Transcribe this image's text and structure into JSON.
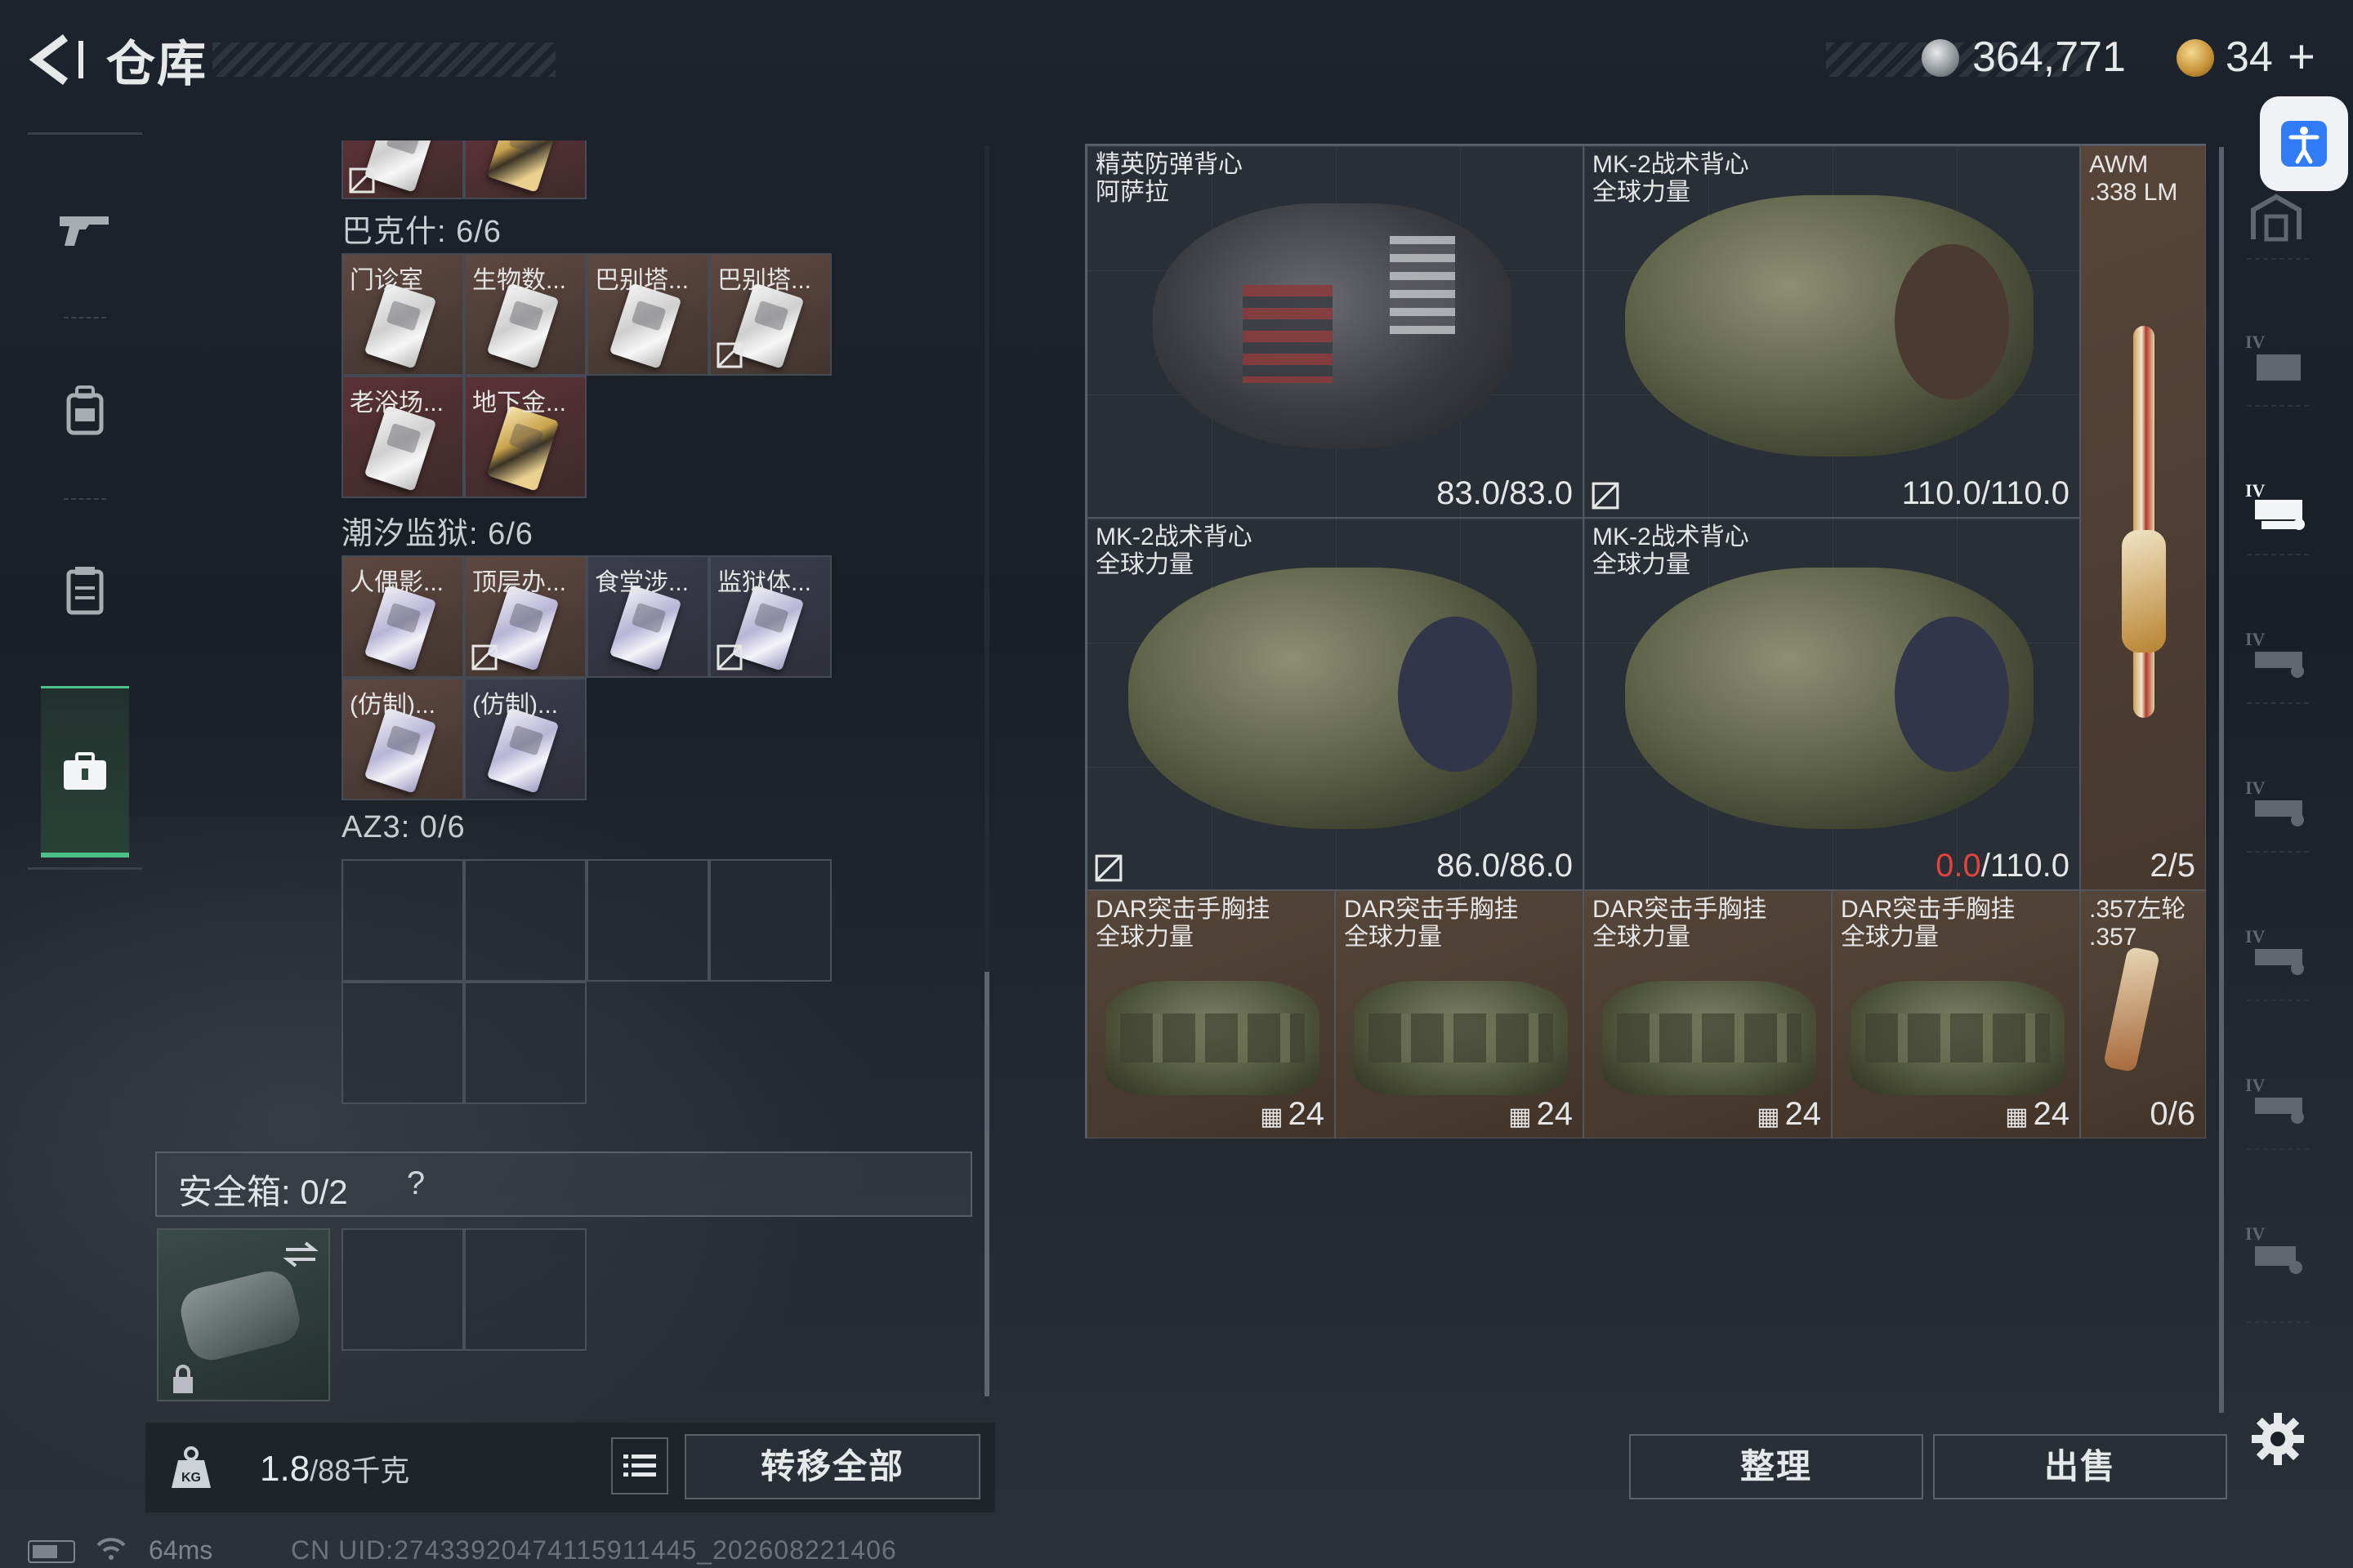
{
  "header": {
    "title": "仓库",
    "currency_silver": "364,771",
    "currency_gold": "34",
    "currency_gold_plus": "+"
  },
  "sections": [
    {
      "label": "巴克什: 6/6",
      "items": [
        {
          "name": "门诊室",
          "card": "silver",
          "cell": "brown"
        },
        {
          "name": "生物数...",
          "card": "silver",
          "cell": "brown"
        },
        {
          "name": "巴别塔...",
          "card": "silver",
          "cell": "brown"
        },
        {
          "name": "巴别塔...",
          "card": "silver",
          "cell": "brown",
          "no_swap": true
        },
        {
          "name": "老浴场...",
          "card": "silver",
          "cell": "red"
        },
        {
          "name": "地下金...",
          "card": "gold",
          "cell": "red"
        }
      ]
    },
    {
      "label": "潮汐监狱: 6/6",
      "items": [
        {
          "name": "人偶影...",
          "card": "violet",
          "cell": "brown"
        },
        {
          "name": "顶层办...",
          "card": "violet",
          "cell": "brown",
          "no_swap": true
        },
        {
          "name": "食堂涉...",
          "card": "violet",
          "cell": "blue"
        },
        {
          "name": "监狱体...",
          "card": "violet",
          "cell": "blue",
          "no_swap": true
        },
        {
          "name": "(仿制)...",
          "card": "violet",
          "cell": "brown"
        },
        {
          "name": "(仿制)...",
          "card": "violet",
          "cell": "blue"
        }
      ]
    },
    {
      "label": "AZ3: 0/6",
      "items": []
    }
  ],
  "safe_box": {
    "label": "安全箱: 0/2",
    "help": "?"
  },
  "weight": {
    "current": "1.8",
    "max": "/88千克"
  },
  "buttons": {
    "transfer_all": "转移全部",
    "sort": "整理",
    "sell": "出售"
  },
  "status": {
    "ping": "64ms",
    "uid": "CN UID:27433920474115911445_202608221406"
  },
  "right_items": {
    "vest1": {
      "line1": "精英防弹背心",
      "line2": "阿萨拉",
      "value": "83.0/83.0"
    },
    "vest2": {
      "line1": "MK-2战术背心",
      "line2": "全球力量",
      "value": "110.0/110.0",
      "no_swap": true
    },
    "awm": {
      "line1": "AWM",
      "line2": ".338 LM",
      "value": "2/5"
    },
    "vest3": {
      "line1": "MK-2战术背心",
      "line2": "全球力量",
      "value": "86.0/86.0",
      "no_swap": true
    },
    "vest4": {
      "line1": "MK-2战术背心",
      "line2": "全球力量",
      "value_red": "0.0",
      "value_rest": "/110.0"
    },
    "rigs": [
      {
        "line1": "DAR突击手胸挂",
        "line2": "全球力量",
        "value": "24"
      },
      {
        "line1": "DAR突击手胸挂",
        "line2": "全球力量",
        "value": "24"
      },
      {
        "line1": "DAR突击手胸挂",
        "line2": "全球力量",
        "value": "24"
      },
      {
        "line1": "DAR突击手胸挂",
        "line2": "全球力量",
        "value": "24"
      }
    ],
    "revolver": {
      "line1": ".357左轮",
      "line2": ".357",
      "value": "0/6"
    }
  },
  "colors": {
    "accent_green": "#4cc187",
    "damage_red": "#e0443c"
  }
}
